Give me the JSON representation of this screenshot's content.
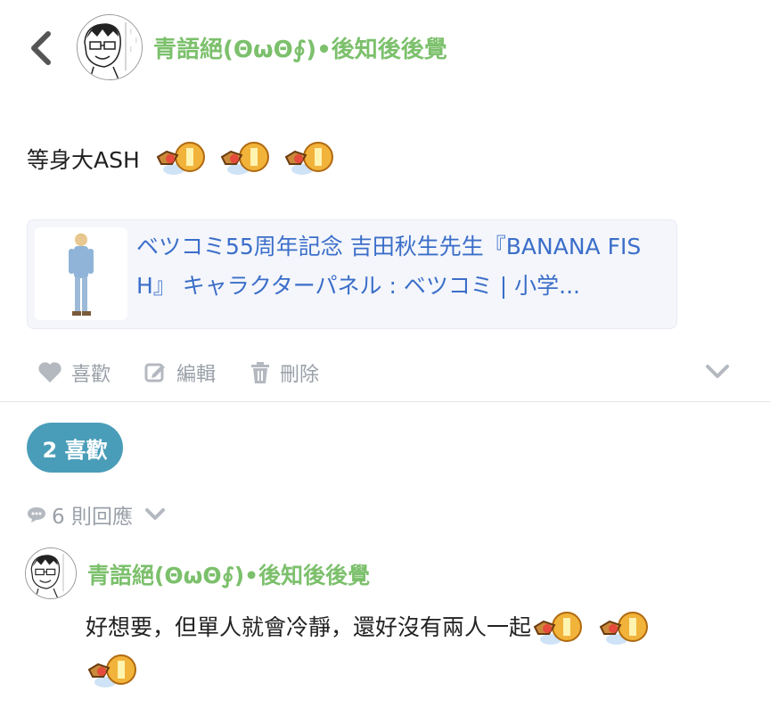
{
  "header": {
    "username": "青語絕(ΘωΘ∮)•後知後後覺"
  },
  "post": {
    "text": "等身大ASH",
    "emoji_count": 3,
    "link_card": {
      "title": "ベツコミ55周年記念 吉田秋生先生『BANANA FISH』 キャラクターパネル : ベツコミ | 小学..."
    }
  },
  "actions": {
    "like_label": "喜歡",
    "edit_label": "編輯",
    "delete_label": "刪除"
  },
  "likes_pill": {
    "label": "2 喜歡"
  },
  "replies": {
    "label": "6 則回應"
  },
  "comment": {
    "username": "青語絕(ΘωΘ∮)•後知後後覺",
    "text": "好想要，但單人就會冷靜，還好沒有兩人一起"
  },
  "colors": {
    "username_green": "#7cc06c",
    "link_blue": "#3b6ec9",
    "pill_blue": "#4a9db9",
    "muted_gray": "#9aa0a8"
  }
}
